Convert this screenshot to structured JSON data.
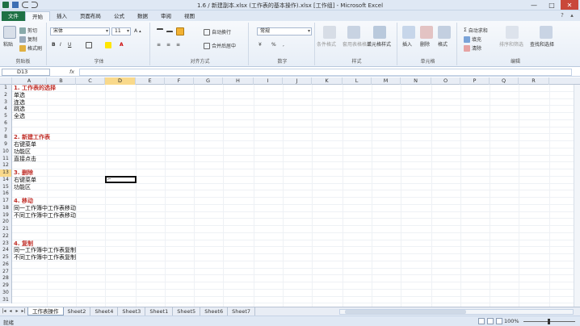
{
  "window": {
    "title": "1.6 / 新建副本.xlsx (工作表的基本操作).xlsx [工作组] - Microsoft Excel",
    "controls": [
      "—",
      "□",
      "✕"
    ]
  },
  "tabs": [
    "文件",
    "开始",
    "插入",
    "页面布局",
    "公式",
    "数据",
    "审阅",
    "视图"
  ],
  "ribbon": {
    "clipboard": {
      "label": "剪贴板",
      "paste": "粘贴",
      "cut": "剪切",
      "copy": "复制",
      "format_painter": "格式刷"
    },
    "font": {
      "label": "字体",
      "name": "宋体",
      "size": "11"
    },
    "alignment": {
      "label": "对齐方式",
      "wrap": "自动换行",
      "merge": "合并后居中"
    },
    "number": {
      "label": "数字",
      "format": "常规"
    },
    "styles": {
      "label": "样式",
      "conditional": "条件格式",
      "table": "套用表格格式",
      "cell": "单元格样式"
    },
    "cells": {
      "label": "单元格",
      "insert": "插入",
      "delete": "删除",
      "format": "格式"
    },
    "editing": {
      "label": "编辑",
      "autosum": "自动求和",
      "fill": "填充",
      "clear": "清除",
      "sort": "排序和筛选",
      "find": "查找和选择"
    }
  },
  "formula_bar": {
    "name_box": "D13",
    "fx": "fx",
    "value": ""
  },
  "columns": [
    "A",
    "B",
    "C",
    "D",
    "E",
    "F",
    "G",
    "H",
    "I",
    "J",
    "K",
    "L",
    "M",
    "N",
    "O",
    "P",
    "Q",
    "R"
  ],
  "selected_column": "D",
  "selected_row": "13",
  "rows": [
    {
      "n": "1",
      "text": "1. 工作表的选择",
      "head": true
    },
    {
      "n": "2",
      "text": "单选",
      "head": false
    },
    {
      "n": "3",
      "text": "连选",
      "head": false
    },
    {
      "n": "4",
      "text": "跳选",
      "head": false
    },
    {
      "n": "5",
      "text": "全选",
      "head": false
    },
    {
      "n": "6",
      "text": "",
      "head": false
    },
    {
      "n": "7",
      "text": "",
      "head": false
    },
    {
      "n": "8",
      "text": "2. 新建工作表",
      "head": true
    },
    {
      "n": "9",
      "text": "右键菜单",
      "head": false
    },
    {
      "n": "10",
      "text": "功能区",
      "head": false
    },
    {
      "n": "11",
      "text": "直接点击",
      "head": false
    },
    {
      "n": "12",
      "text": "",
      "head": false
    },
    {
      "n": "13",
      "text": "3. 删除",
      "head": true
    },
    {
      "n": "14",
      "text": "右键菜单",
      "head": false
    },
    {
      "n": "15",
      "text": "功能区",
      "head": false
    },
    {
      "n": "16",
      "text": "",
      "head": false
    },
    {
      "n": "17",
      "text": "4. 移动",
      "head": true
    },
    {
      "n": "18",
      "text": "同一工作簿中工作表移动",
      "head": false
    },
    {
      "n": "19",
      "text": "不同工作簿中工作表移动",
      "head": false
    },
    {
      "n": "20",
      "text": "",
      "head": false
    },
    {
      "n": "21",
      "text": "",
      "head": false
    },
    {
      "n": "22",
      "text": "",
      "head": false
    },
    {
      "n": "23",
      "text": "4. 复制",
      "head": true
    },
    {
      "n": "24",
      "text": "同一工作簿中工作表复制",
      "head": false
    },
    {
      "n": "25",
      "text": "不同工作簿中工作表复制",
      "head": false
    },
    {
      "n": "26",
      "text": "",
      "head": false
    },
    {
      "n": "27",
      "text": "",
      "head": false
    },
    {
      "n": "28",
      "text": "",
      "head": false
    },
    {
      "n": "29",
      "text": "",
      "head": false
    },
    {
      "n": "30",
      "text": "",
      "head": false
    },
    {
      "n": "31",
      "text": "",
      "head": false
    }
  ],
  "sheet_tabs": [
    "工作表操作",
    "Sheet2",
    "Sheet4",
    "Sheet3",
    "Sheet1",
    "Sheet5",
    "Sheet6",
    "Sheet7"
  ],
  "active_sheet": "工作表操作",
  "status": {
    "text": "就绪",
    "zoom": "100%"
  }
}
